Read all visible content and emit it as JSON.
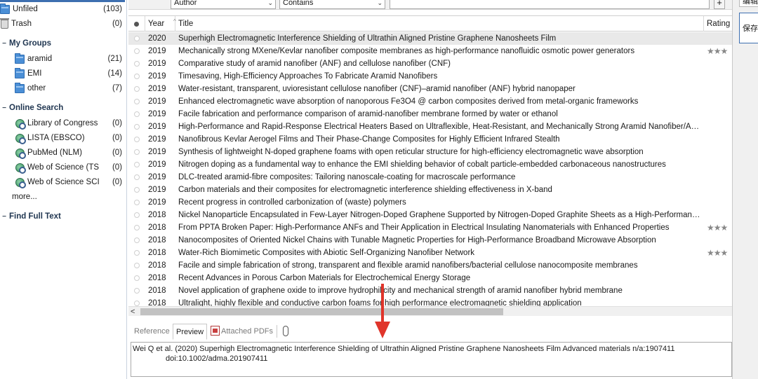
{
  "sidebar": {
    "unfiled": {
      "label": "Unfiled",
      "count": "(103)"
    },
    "trash": {
      "label": "Trash",
      "count": "(0)"
    },
    "my_groups": {
      "title": "My Groups",
      "items": [
        {
          "label": "aramid",
          "count": "(21)"
        },
        {
          "label": "EMI",
          "count": "(14)"
        },
        {
          "label": "other",
          "count": "(7)"
        }
      ]
    },
    "online_search": {
      "title": "Online Search",
      "items": [
        {
          "label": "Library of Congress",
          "count": "(0)"
        },
        {
          "label": "LISTA (EBSCO)",
          "count": "(0)"
        },
        {
          "label": "PubMed (NLM)",
          "count": "(0)"
        },
        {
          "label": "Web of Science (TS)",
          "count": "(0)"
        },
        {
          "label": "Web of Science SCI (...",
          "count": "(0)"
        }
      ],
      "more": "more..."
    },
    "find_full_text": {
      "title": "Find Full Text"
    }
  },
  "search": {
    "field": "Author",
    "operator": "Contains",
    "value": "",
    "add_button": "+"
  },
  "table": {
    "columns": {
      "year": "Year",
      "title": "Title",
      "rating": "Rating"
    },
    "rows": [
      {
        "year": "2020",
        "title": "Superhigh Electromagnetic Interference Shielding of Ultrathin Aligned Pristine Graphene Nanosheets Film",
        "rating": ""
      },
      {
        "year": "2019",
        "title": "Mechanically strong MXene/Kevlar nanofiber composite membranes as high-performance nanofluidic osmotic power generators",
        "rating": "★★★"
      },
      {
        "year": "2019",
        "title": "Comparative study of aramid nanofiber (ANF) and cellulose nanofiber (CNF)",
        "rating": ""
      },
      {
        "year": "2019",
        "title": "Timesaving, High-Efficiency Approaches To Fabricate Aramid Nanofibers",
        "rating": ""
      },
      {
        "year": "2019",
        "title": "Water-resistant, transparent, uvioresistant cellulose nanofiber (CNF)–aramid nanofiber (ANF) hybrid nanopaper",
        "rating": ""
      },
      {
        "year": "2019",
        "title": "Enhanced electromagnetic wave absorption of nanoporous Fe3O4 @ carbon composites derived from metal-organic frameworks",
        "rating": ""
      },
      {
        "year": "2019",
        "title": "Facile fabrication and performance comparison of aramid-nanofiber membrane formed by water or ethanol",
        "rating": ""
      },
      {
        "year": "2019",
        "title": "High-Performance and Rapid-Response Electrical Heaters Based on Ultraflexible, Heat-Resistant, and Mechanically Strong Aramid Nanofiber/Ag N...",
        "rating": ""
      },
      {
        "year": "2019",
        "title": "Nanofibrous Kevlar Aerogel Films and Their Phase-Change Composites for Highly Efficient Infrared Stealth",
        "rating": ""
      },
      {
        "year": "2019",
        "title": "Synthesis of lightweight N-doped graphene foams with open reticular structure for high-efficiency electromagnetic wave absorption",
        "rating": ""
      },
      {
        "year": "2019",
        "title": "Nitrogen doping as a fundamental way to enhance the EMI shielding behavior of cobalt particle-embedded carbonaceous nanostructures",
        "rating": ""
      },
      {
        "year": "2019",
        "title": "DLC-treated aramid-fibre composites: Tailoring nanoscale-coating for macroscale performance",
        "rating": ""
      },
      {
        "year": "2019",
        "title": "Carbon materials and their composites for electromagnetic interference shielding effectiveness in X-band",
        "rating": ""
      },
      {
        "year": "2019",
        "title": "Recent progress in controlled carbonization of (waste) polymers",
        "rating": ""
      },
      {
        "year": "2018",
        "title": "Nickel Nanoparticle Encapsulated in Few-Layer Nitrogen-Doped Graphene Supported by Nitrogen-Doped Graphite Sheets as a High-Performance ...",
        "rating": ""
      },
      {
        "year": "2018",
        "title": "From PPTA Broken Paper: High-Performance ANFs and Their Application in Electrical Insulating Nanomaterials with Enhanced Properties",
        "rating": "★★★"
      },
      {
        "year": "2018",
        "title": "Nanocomposites of Oriented Nickel Chains with Tunable Magnetic Properties for High-Performance Broadband Microwave Absorption",
        "rating": ""
      },
      {
        "year": "2018",
        "title": "Water-Rich Biomimetic Composites with Abiotic Self-Organizing Nanofiber Network",
        "rating": "★★★"
      },
      {
        "year": "2018",
        "title": "Facile and simple fabrication of strong, transparent and flexible aramid nanofibers/bacterial cellulose nanocomposite membranes",
        "rating": ""
      },
      {
        "year": "2018",
        "title": "Recent Advances in Porous Carbon Materials for Electrochemical Energy Storage",
        "rating": ""
      },
      {
        "year": "2018",
        "title": "Novel application of graphene oxide to improve hydrophilicity and mechanical strength of aramid nanofiber hybrid membrane",
        "rating": ""
      },
      {
        "year": "2018",
        "title": "Ultralight, highly flexible and conductive carbon foams for high performance electromagnetic shielding application",
        "rating": ""
      }
    ]
  },
  "tabs": {
    "reference": "Reference",
    "preview": "Preview",
    "attached_pdfs": "Attached PDFs"
  },
  "preview": {
    "line1": "Wei Q et al. (2020) Superhigh Electromagnetic Interference Shielding of Ultrathin Aligned Pristine Graphene Nanosheets Film Advanced materials n/a:1907411",
    "line2": "doi:10.1002/adma.201907411"
  },
  "right_panel": {
    "top_button": "编辑",
    "save_button": "保存"
  },
  "colors": {
    "accent": "#3d6fb0",
    "arrow": "#e0352b",
    "selected_row": "#e9e9e9",
    "folder": "#4b8fd6"
  }
}
